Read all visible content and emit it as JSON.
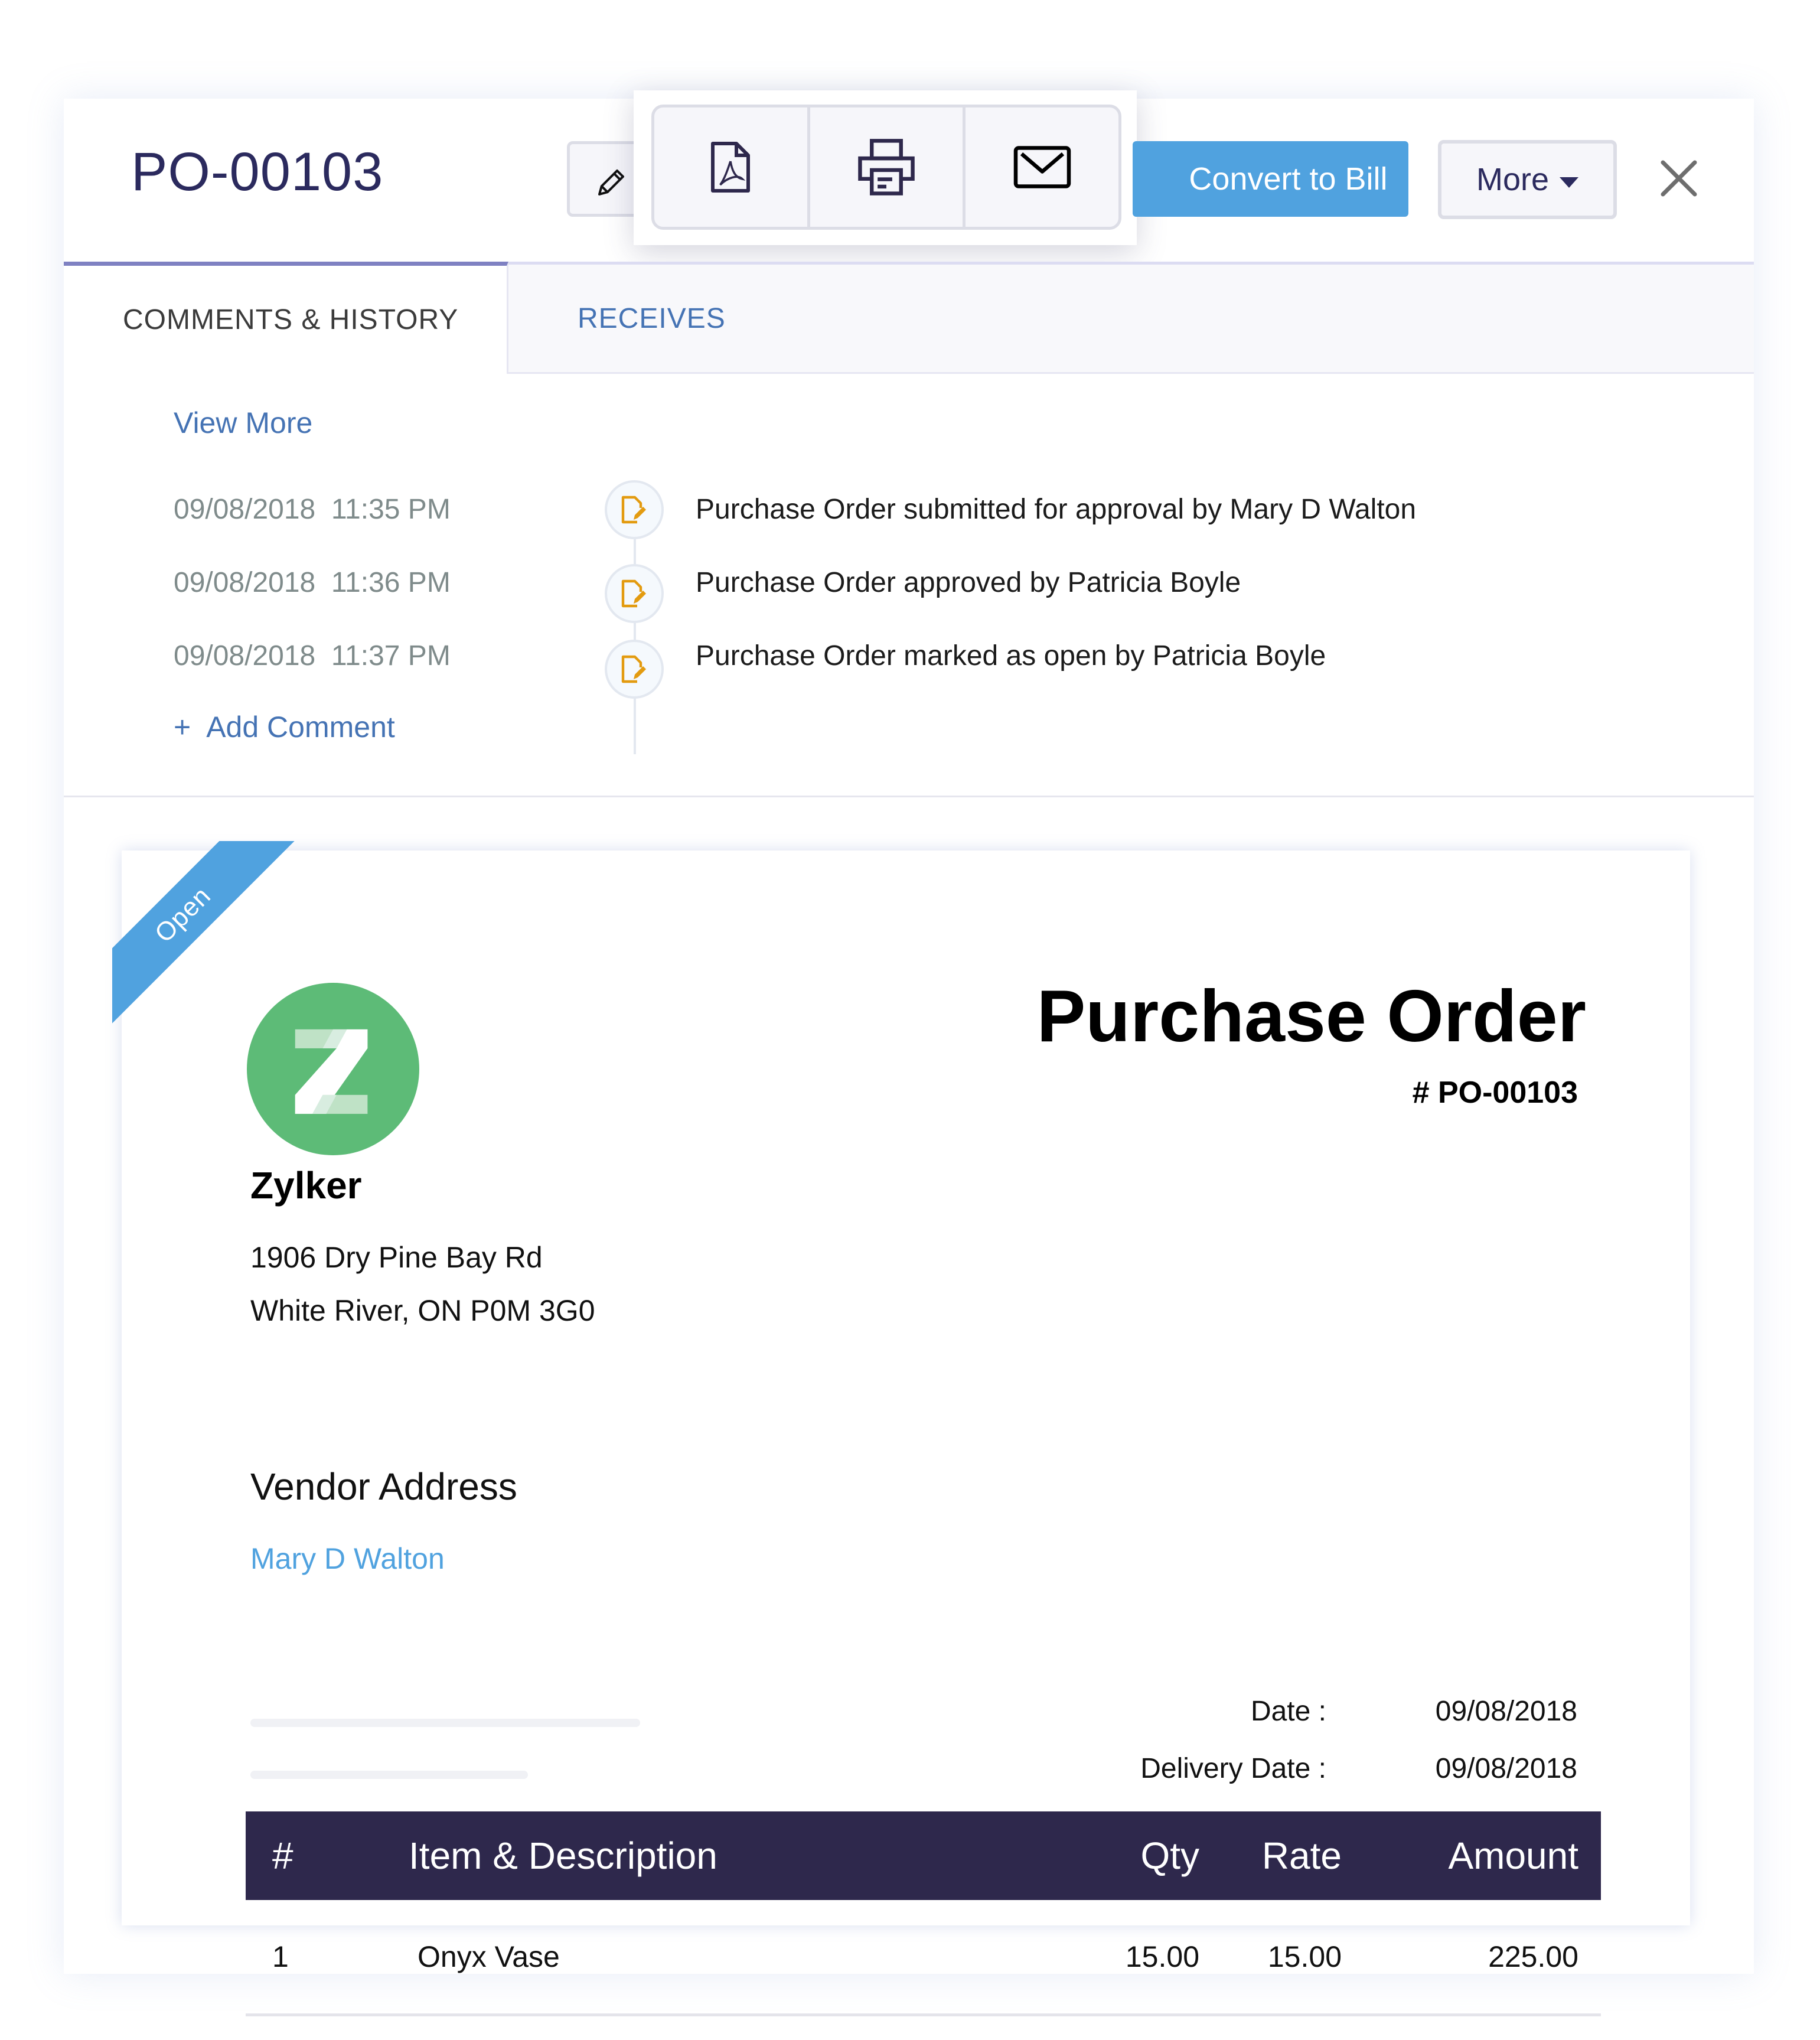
{
  "header": {
    "title": "PO-00103",
    "edit_icon": "pencil-icon",
    "share_icons": [
      "pdf-icon",
      "print-icon",
      "mail-icon"
    ],
    "convert_label": "Convert to Bill",
    "more_label": "More",
    "close_icon": "close-icon"
  },
  "tabs": [
    {
      "label": "COMMENTS & HISTORY",
      "active": true
    },
    {
      "label": "RECEIVES",
      "active": false
    }
  ],
  "comments": {
    "view_more": "View More",
    "history": [
      {
        "date": "09/08/2018",
        "time": "11:35 PM",
        "datetime": "09/08/2018  11:35 PM",
        "icon": "document-edit-icon",
        "text": "Purchase Order submitted for approval by Mary D Walton"
      },
      {
        "date": "09/08/2018",
        "time": "11:36 PM",
        "datetime": "09/08/2018  11:36 PM",
        "icon": "document-edit-icon",
        "text": "Purchase Order approved by Patricia Boyle"
      },
      {
        "date": "09/08/2018",
        "time": "11:37 PM",
        "datetime": "09/08/2018  11:37 PM",
        "icon": "document-edit-icon",
        "text": "Purchase Order marked as open by Patricia Boyle"
      }
    ],
    "add_comment_plus": "+",
    "add_comment": "Add Comment"
  },
  "document": {
    "status_ribbon": "Open",
    "logo_letter": "Z",
    "company": {
      "name": "Zylker",
      "address_line1": "1906 Dry Pine Bay Rd",
      "address_line2": "White River, ON P0M 3G0"
    },
    "title": "Purchase Order",
    "number": "# PO-00103",
    "vendor_heading": "Vendor Address",
    "vendor_name": "Mary D Walton",
    "meta": [
      {
        "label": "Date :",
        "value": "09/08/2018"
      },
      {
        "label": "Delivery Date :",
        "value": "09/08/2018"
      }
    ],
    "table": {
      "headers": [
        "#",
        "Item & Description",
        "Qty",
        "Rate",
        "Amount"
      ],
      "rows": [
        {
          "num": "1",
          "item": "Onyx Vase",
          "qty": "15.00",
          "rate": "15.00",
          "amount": "225.00"
        }
      ]
    }
  },
  "colors": {
    "accent_blue": "#50a2df",
    "title_navy": "#2b2a5e",
    "link_blue": "#4573b4",
    "table_header": "#2e284c",
    "history_icon": "#e39b10",
    "logo_green": "#5dbb77"
  }
}
